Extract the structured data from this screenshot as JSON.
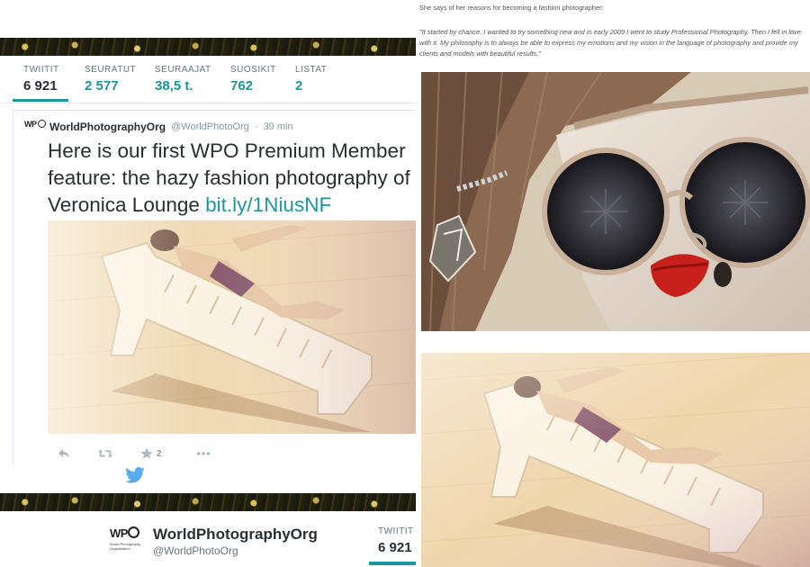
{
  "profile_stats": [
    {
      "label": "TWIITIT",
      "value": "6 921",
      "active": true
    },
    {
      "label": "SEURATUT",
      "value": "2 577",
      "active": false
    },
    {
      "label": "SEURAAJAT",
      "value": "38,5 t.",
      "active": false
    },
    {
      "label": "SUOSIKIT",
      "value": "762",
      "active": false
    },
    {
      "label": "LISTAT",
      "value": "2",
      "active": false
    }
  ],
  "tweet": {
    "avatar_text": "WP",
    "author_name": "WorldPhotographyOrg",
    "author_handle": "@WorldPhotoOrg",
    "separator": "·",
    "time": "39 min",
    "text": "Here is our first WPO Premium Member feature: the hazy fashion photography of Veronica Lounge ",
    "link": "bit.ly/1NiusNF",
    "favorite_count": "2",
    "icons": [
      "reply-icon",
      "retweet-icon",
      "favorite-icon",
      "more-icon"
    ]
  },
  "profile_card": {
    "logo_text": "WP",
    "logo_sub": "World Photography Organisation",
    "name": "WorldPhotographyOrg",
    "handle": "@WorldPhotoOrg",
    "stat_label": "TWIITIT",
    "stat_value": "6 921"
  },
  "article": {
    "intro": "She says of her reasons for becoming a fashion photographer:",
    "quote": "\"It started by chance. I wanted to try something new and in early 2009 I went to study Professional Photography. Then I fell in love with it. My philosophy is to always be able to express my emotions and my vision in the language of photography and provide my clients and models with beautiful results.\""
  },
  "colors": {
    "accent": "#1b95a0",
    "text": "#292f33",
    "muted": "#8899a6",
    "lip_red": "#c8211b"
  }
}
